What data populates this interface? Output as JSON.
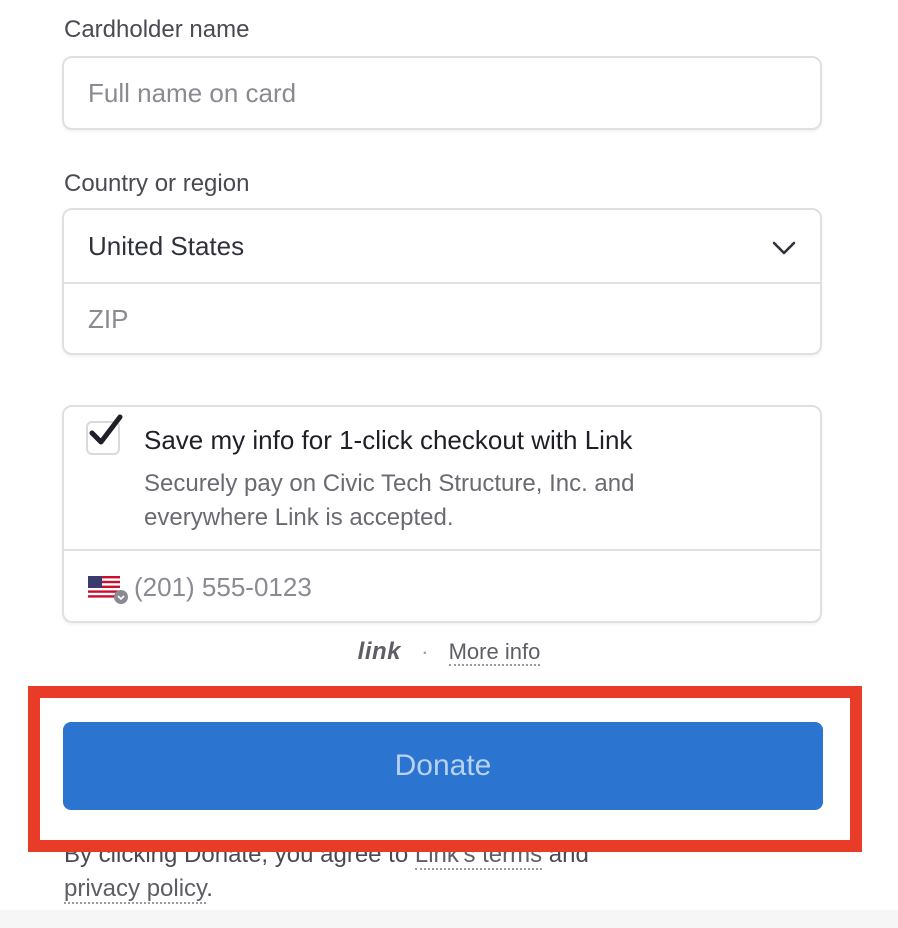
{
  "cardholder": {
    "label": "Cardholder name",
    "placeholder": "Full name on card"
  },
  "country": {
    "label": "Country or region",
    "selected": "United States",
    "zip_placeholder": "ZIP"
  },
  "link_box": {
    "checkbox_checked": true,
    "title": "Save my info for 1-click checkout with Link",
    "description": "Securely pay on Civic Tech Structure, Inc. and everywhere Link is accepted.",
    "phone_placeholder": "(201) 555-0123"
  },
  "link_footer": {
    "logo": "link",
    "separator": "·",
    "more_info": "More info"
  },
  "donate": {
    "label": "Donate"
  },
  "terms": {
    "prefix": "By clicking Donate, you agree to ",
    "link_terms": "Link's terms",
    "middle": " and ",
    "privacy": "privacy policy",
    "suffix": "."
  },
  "colors": {
    "accent": "#2b74d0",
    "highlight": "#e83b28"
  }
}
